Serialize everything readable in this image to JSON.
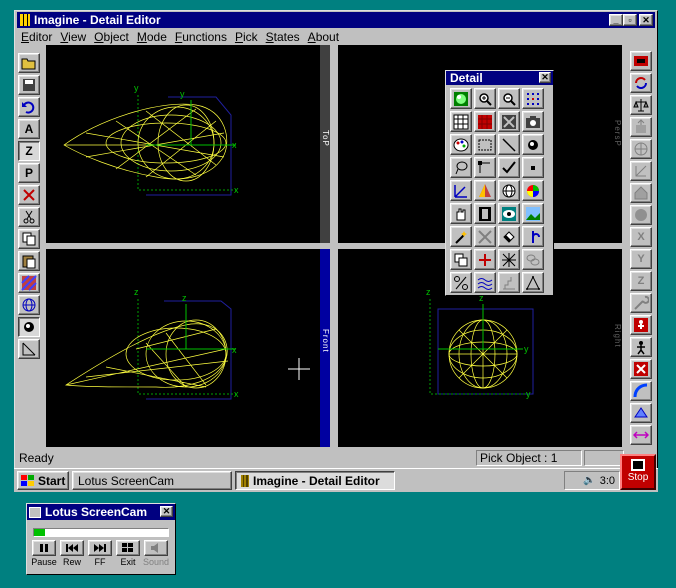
{
  "window": {
    "title": "Imagine - Detail Editor"
  },
  "menu": [
    "Editor",
    "View",
    "Object",
    "Mode",
    "Functions",
    "Pick",
    "States",
    "About"
  ],
  "left_toolbar": [
    "open-icon",
    "save-icon",
    "undo-icon",
    "A",
    "Z",
    "P",
    "delete-icon",
    "cut-icon",
    "copy-icon",
    "paste-icon",
    "texture-icon",
    "sphere-icon",
    "circle-icon",
    "transform-icon"
  ],
  "left_toolbar_text": {
    "a": "A",
    "z": "Z",
    "p": "P"
  },
  "viewports": {
    "top": "ToP",
    "front": "Front",
    "right": "Right",
    "persp": "PersP"
  },
  "axes": {
    "x": "x",
    "y": "y",
    "z": "z"
  },
  "detail": {
    "title": "Detail",
    "tools": [
      "shaded-sphere-icon",
      "zoom-in-icon",
      "zoom-out-icon",
      "dots-icon",
      "grid-icon",
      "red-square-icon",
      "rotate-box-icon",
      "camera-icon",
      "palette-icon",
      "select-box-icon",
      "line-icon",
      "circle-fill-icon",
      "lasso-icon",
      "node-icon",
      "check-icon",
      "point-icon",
      "axis-icon",
      "cone-icon",
      "globe-icon",
      "color-wheel-icon",
      "hand-icon",
      "film-icon",
      "eye-icon",
      "landscape-icon",
      "magic-icon",
      "tools-icon",
      "fill-icon",
      "merge-icon",
      "copy-icon",
      "plus-icon",
      "star-icon",
      "chain-icon",
      "percent-icon",
      "waves-icon",
      "stairs-icon",
      "triangle-icon"
    ]
  },
  "right_toolbar": [
    "record-icon",
    "rotate-icon",
    "scale-icon",
    "move-icon",
    "sphere-icon",
    "edge-icon",
    "house-icon",
    "ball-icon",
    "X",
    "Y",
    "Z",
    "wrench-icon",
    "figure-red-icon",
    "figure-icon",
    "x-red-icon",
    "curve-icon",
    "plane-icon",
    "arrows-icon"
  ],
  "status": {
    "ready": "Ready",
    "pick": "Pick Object : 1"
  },
  "taskbar": {
    "start": "Start",
    "task1": "Lotus ScreenCam",
    "task2": "Imagine - Detail Editor",
    "clock": "3:0",
    "stop": "Stop"
  },
  "screencam": {
    "title": "Lotus ScreenCam",
    "progress": 0.08,
    "buttons": [
      "Pause",
      "Rew",
      "FF",
      "Exit",
      "Sound"
    ]
  },
  "colors": {
    "titlebar": "#000080",
    "desktop": "#008080",
    "mesh": "#ffff40",
    "axis": "#00c000",
    "bounds": "#2020a0"
  }
}
